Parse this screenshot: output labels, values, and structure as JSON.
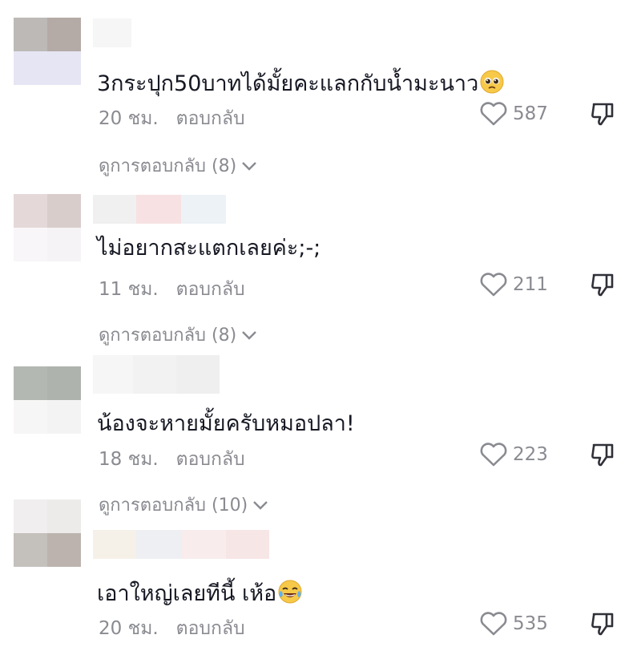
{
  "comments": [
    {
      "text": "3กระปุก50บาทได้มั้ยคะแลกกับน้ำมะนาว",
      "emoji": "pleading-face",
      "time": "20 ชม.",
      "reply_label": "ตอบกลับ",
      "likes": "587",
      "view_replies": "ดูการตอบกลับ (8)"
    },
    {
      "text": "ไม่อยากสะแตกเลยค่ะ;-;",
      "time": "11 ชม.",
      "reply_label": "ตอบกลับ",
      "likes": "211",
      "view_replies": "ดูการตอบกลับ (8)"
    },
    {
      "text": "น้องจะหายมั้ยครับหมอปลา!",
      "time": "18 ชม.",
      "reply_label": "ตอบกลับ",
      "likes": "223",
      "view_replies": "ดูการตอบกลับ (10)"
    },
    {
      "text": "เอาใหญ่เลยทีนี้ เห้อ",
      "emoji": "tears-of-joy",
      "time": "20 ชม.",
      "reply_label": "ตอบกลับ",
      "likes": "535"
    }
  ],
  "colors": {
    "text": "#161823",
    "secondary": "#8a8b91",
    "background": "#ffffff"
  }
}
